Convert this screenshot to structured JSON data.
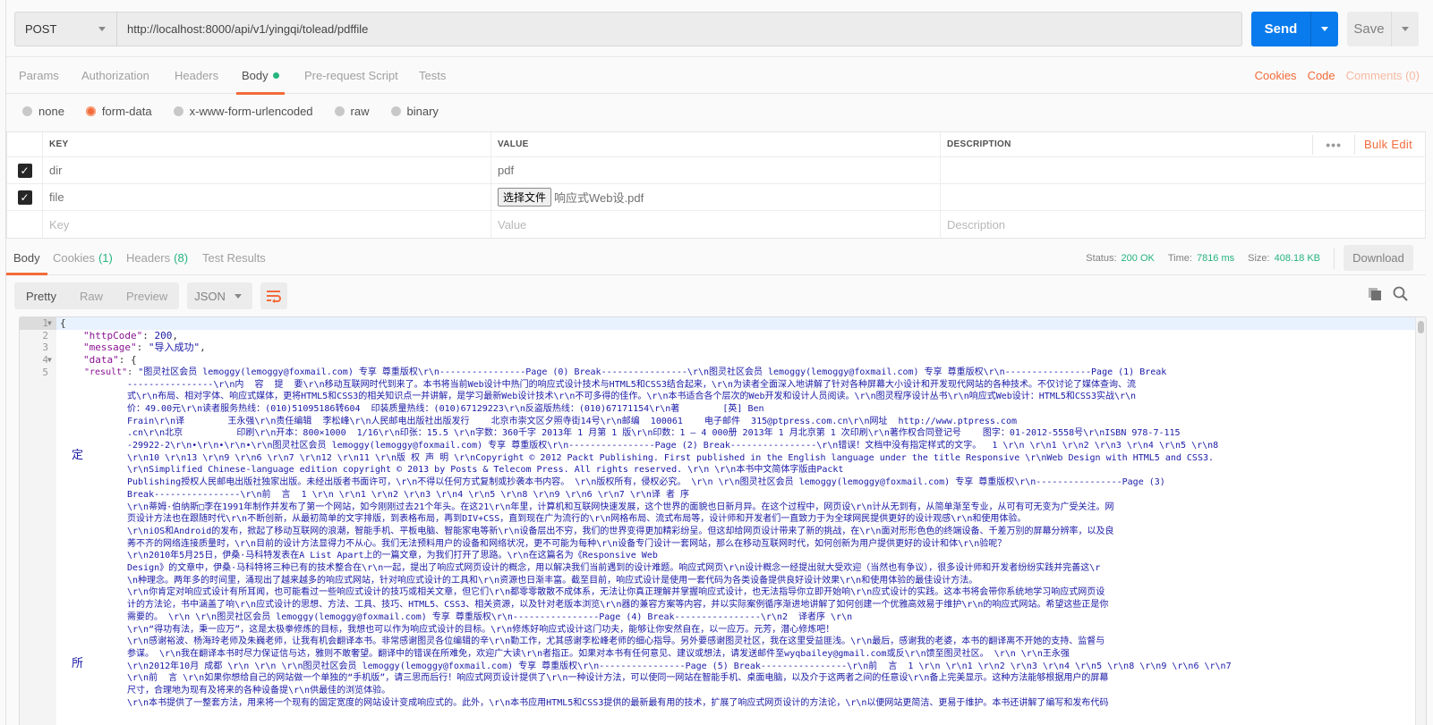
{
  "request": {
    "method": "POST",
    "url": "http://localhost:8000/api/v1/yingqi/tolead/pdffile",
    "send_label": "Send",
    "save_label": "Save"
  },
  "request_tabs": [
    {
      "label": "Params",
      "active": false
    },
    {
      "label": "Authorization",
      "active": false
    },
    {
      "label": "Headers",
      "active": false
    },
    {
      "label": "Body",
      "active": true
    },
    {
      "label": "Pre-request Script",
      "active": false
    },
    {
      "label": "Tests",
      "active": false
    }
  ],
  "request_links": {
    "cookies": "Cookies",
    "code": "Code",
    "comments": "Comments (0)"
  },
  "body_types": [
    {
      "label": "none",
      "selected": false
    },
    {
      "label": "form-data",
      "selected": true
    },
    {
      "label": "x-www-form-urlencoded",
      "selected": false
    },
    {
      "label": "raw",
      "selected": false
    },
    {
      "label": "binary",
      "selected": false
    }
  ],
  "params_table": {
    "headers": {
      "key": "KEY",
      "value": "VALUE",
      "description": "DESCRIPTION"
    },
    "bulk_edit": "Bulk Edit",
    "more": "•••",
    "rows": [
      {
        "checked": true,
        "key": "dir",
        "value": "pdf",
        "description": ""
      },
      {
        "checked": true,
        "key": "file",
        "file_button": "选择文件",
        "value": "响应式Web设.pdf",
        "description": ""
      }
    ],
    "placeholders": {
      "key": "Key",
      "value": "Value",
      "description": "Description"
    }
  },
  "response_tabs": [
    {
      "label": "Body",
      "count": "",
      "active": true
    },
    {
      "label": "Cookies",
      "count": "(1)",
      "active": false
    },
    {
      "label": "Headers",
      "count": "(8)",
      "active": false
    },
    {
      "label": "Test Results",
      "count": "",
      "active": false
    }
  ],
  "response_meta": {
    "status_label": "Status:",
    "status": "200 OK",
    "time_label": "Time:",
    "time": "7816 ms",
    "size_label": "Size:",
    "size": "408.18 KB",
    "download": "Download"
  },
  "view_modes": [
    {
      "label": "Pretty",
      "active": true
    },
    {
      "label": "Raw",
      "active": false
    },
    {
      "label": "Preview",
      "active": false
    }
  ],
  "format": "JSON",
  "colors": {
    "accent": "#f26b3a",
    "send": "#097bed",
    "success": "#26b47f"
  },
  "code": {
    "line1": "{",
    "line2_key": "\"httpCode\"",
    "line2_val": "200",
    "line3_key": "\"message\"",
    "line3_val": "\"导入成功\"",
    "line4_key": "\"data\"",
    "line4_val": "{",
    "line5_key": "\"result\"",
    "margin_chars": [
      "定",
      "所"
    ],
    "result_lines": [
      "\"图灵社区会员 lemoggy(lemoggy@foxmail.com) 专享 尊重版权\\r\\n----------------Page (0) Break----------------\\r\\n图灵社区会员 lemoggy(lemoggy@foxmail.com) 专享 尊重版权\\r\\n----------------Page (1) Break",
      "----------------\\r\\n内  容  提  要\\r\\n移动互联网时代到来了。本书将当前Web设计中热门的响应式设计技术与HTML5和CSS3结合起来，\\r\\n为读者全面深入地讲解了针对各种屏幕大小设计和开发现代网站的各种技术。不仅讨论了媒体查询、流",
      "式\\r\\n布局、相对字体、响应式媒体，更将HTML5和CSS3的相关知识点一并讲解，是学习最新Web设计技术\\r\\n不可多得的佳作。\\r\\n本书适合各个层次的Web开发和设计人员阅读。\\r\\n图灵程序设计丛书\\r\\n响应式Web设计：HTML5和CSS3实战\\r\\n",
      "价：49.00元\\r\\n读者服务热线：(010)51095186转604  印装质量热线：(010)67129223\\r\\n反盗版热线：(010)67171154\\r\\n著        [英] Ben",
      "Frain\\r\\n译        王永强\\r\\n责任编辑  李松峰\\r\\n人民邮电出版社出版发行    北京市崇文区夕照寺街14号\\r\\n邮编  100061    电子邮件  315@ptpress.com.cn\\r\\n网址  http://www.ptpress.com",
      ".cn\\r\\n北京          印刷\\r\\n开本：800×1000  1/16\\r\\n印张：15.5 \\r\\n字数：360千字 2013年 1 月第 1 版\\r\\n印数：1 – 4 000册 2013年 1 月北京第 1 次印刷\\r\\n著作权合同登记号    图字：01-2012-5558号\\r\\nISBN 978-7-115",
      "-29922-2\\r\\n•\\r\\n•\\r\\n•\\r\\n图灵社区会员 lemoggy(lemoggy@foxmail.com) 专享 尊重版权\\r\\n----------------Page (2) Break----------------\\r\\n错误！文档中没有指定样式的文字。  1 \\r\\n \\r\\n1 \\r\\n2 \\r\\n3 \\r\\n4 \\r\\n5 \\r\\n8",
      "\\r\\n10 \\r\\n13 \\r\\n9 \\r\\n6 \\r\\n7 \\r\\n12 \\r\\n11 \\r\\n版 权 声 明 \\r\\nCopyright © 2012 Packt Publishing. First published in the English language under the title Responsive \\r\\nWeb Design with HTML5 and CSS3.",
      "\\r\\nSimplified Chinese-language edition copyright © 2013 by Posts & Telecom Press. All rights reserved. \\r\\n \\r\\n本书中文简体字版由Packt",
      "Publishing授权人民邮电出版社独家出版。未经出版者书面许可，\\r\\n不得以任何方式复制或抄袭本书内容。 \\r\\n版权所有，侵权必究。 \\r\\n \\r\\n图灵社区会员 lemoggy(lemoggy@foxmail.com) 专享 尊重版权\\r\\n----------------Page (3)",
      "Break----------------\\r\\n前  言  1 \\r\\n \\r\\n1 \\r\\n2 \\r\\n3 \\r\\n4 \\r\\n5 \\r\\n8 \\r\\n9 \\r\\n6 \\r\\n7 \\r\\n译 者 序",
      "\\r\\n蒂姆·伯纳斯□李在1991年制作并发布了第一个网站，如今刚刚过去21个年头。在这21\\r\\n年里，计算机和互联网快速发展，这个世界的面貌也日新月异。在这个过程中，网页设\\r\\n计从无到有，从简单渐至专业，从可有可无变为广受关注。网",
      "页设计方法也在跟随时代\\r\\n不断创新，从最初简单的文字排版，到表格布局，再到DIV+CSS，直到现在广为流行的\\r\\n网格布局、流式布局等，设计师和开发者们一直致力于为全球网民提供更好的设计观感\\r\\n和使用体验。",
      "\\r\\niOS和Android的发布，掀起了移动互联网的浪潮，智能手机、平板电脑、智能家电等新\\r\\n设备层出不穷，我们的世界变得更加精彩纷呈。但这却给网页设计带来了新的挑战，在\\r\\n面对形形色色的终端设备、千差万别的屏幕分辨率，以及良",
      "莠不齐的网络连接质量时，\\r\\n目前的设计方法显得力不从心。我们无法预料用户的设备和网络状况，更不可能为每种\\r\\n设备专门设计一套网站，那么在移动互联网时代，如何创新为用户提供更好的设计和体\\r\\n验呢？",
      "\\r\\n2010年5月25日，伊桑·马科特发表在A List Apart上的一篇文章，为我们打开了思路。\\r\\n在这篇名为《Responsive Web",
      "Design》的文章中，伊桑·马科特将三种已有的技术整合在\\r\\n一起，提出了响应式网页设计的概念，用以解决我们当前遇到的设计难题。响应式网页\\r\\n设计概念一经提出就大受欢迎（当然也有争议），很多设计师和开发者纷纷实践并完善这\\r",
      "\\n种理念。两年多的时间里，涌现出了越来越多的响应式网站，针对响应式设计的工具和\\r\\n资源也日渐丰富。截至目前，响应式设计是使用一套代码为各类设备提供良好设计效果\\r\\n和使用体验的最佳设计方法。",
      "\\r\\n你肯定对响应式设计有所耳闻，也可能看过一些响应式设计的技巧或相关文章，但它们\\r\\n都零零散散不成体系，无法让你真正理解并掌握响应式设计，也无法指导你立即开始响\\r\\n应式设计的实践。这本书将会带你系统地学习响应式网页设",
      "计的方法论，书中涵盖了响\\r\\n应式设计的思想、方法、工具、技巧、HTML5、CSS3、相关资源，以及针对老版本浏览\\r\\n器的兼容方案等内容，并以实际案例循序渐进地讲解了如何创建一个优雅高效易于维护\\r\\n的响应式网站。希望这些正是你",
      "需要的。 \\r\\n \\r\\n图灵社区会员 lemoggy(lemoggy@foxmail.com) 专享 尊重版权\\r\\n----------------Page (4) Break----------------\\r\\n2  译者序 \\r\\n",
      "\\r\\n“得功有法，秉一应万”，这是太极拳修炼的目标，我想也可以作为响应式设计的目标。\\r\\n修炼好响应式设计这门功夫，能够让你安然自在，以一应万。元芳，潜心修炼吧！",
      "\\r\\n感谢裕波、杨海玲老师及朱巍老师，让我有机会翻译本书。非常感谢图灵各位编辑的辛\\r\\n勤工作，尤其感谢李松峰老师的细心指导。另外要感谢图灵社区，我在这里受益匪浅。\\r\\n最后，感谢我的老婆，本书的翻译离不开她的支持、监督与",
      "参谋。 \\r\\n我在翻译本书时尽力保证信与达，雅则不敢奢望。翻译中的错误在所难免，欢迎广大读\\r\\n者指正。如果对本书有任何意见、建议或想法，请发送邮件至wyqbailey@gmail.com或反\\r\\n馈至图灵社区。 \\r\\n \\r\\n王永强",
      "\\r\\n2012年10月 成都 \\r\\n \\r\\n \\r\\n图灵社区会员 lemoggy(lemoggy@foxmail.com) 专享 尊重版权\\r\\n----------------Page (5) Break----------------\\r\\n前  言  1 \\r\\n \\r\\n1 \\r\\n2 \\r\\n3 \\r\\n4 \\r\\n5 \\r\\n8 \\r\\n9 \\r\\n6 \\r\\n7",
      "\\r\\n前  言 \\r\\n如果你想给自己的网站做一个单独的“手机版”，请三思而后行！响应式网页设计提供了\\r\\n一种设计方法，可以使同一网站在智能手机、桌面电脑，以及介于这两者之间的任意设\\r\\n备上完美显示。这种方法能够根据用户的屏幕",
      "尺寸，合理地为现有及将来的各种设备提\\r\\n供最佳的浏览体验。",
      "\\r\\n本书提供了一整套方法，用来将一个现有的固定宽度的网站设计变成响应式的。此外，\\r\\n本书应用HTML5和CSS3提供的最新最有用的技术，扩展了响应式网页设计的方法论，\\r\\n以便网站更简洁、更易于维护。本书还讲解了编写和发布代码"
    ]
  }
}
